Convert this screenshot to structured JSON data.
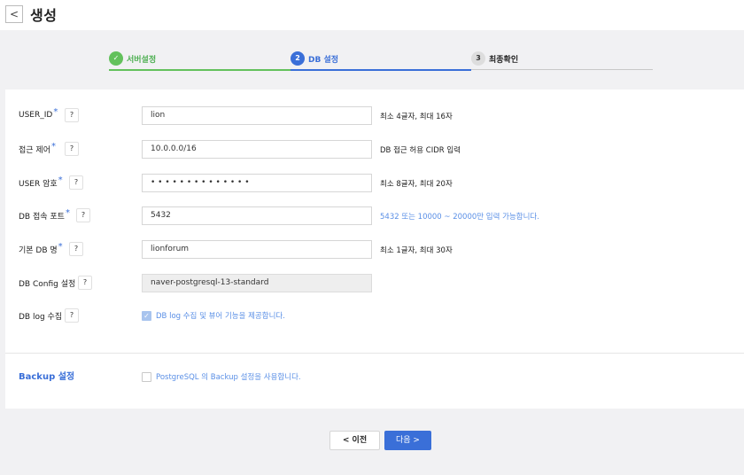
{
  "header": {
    "back_icon": "chevron-left-icon",
    "back_glyph": "<",
    "title": "생성"
  },
  "steps": [
    {
      "label": "서버설정",
      "marker": "✓",
      "state": "done"
    },
    {
      "label": "DB 설정",
      "marker": "2",
      "state": "active"
    },
    {
      "label": "최종확인",
      "marker": "3",
      "state": "pending"
    }
  ],
  "form": {
    "help_glyph": "?",
    "required_mark": "*",
    "user_id": {
      "label": "USER_ID",
      "value": "lion",
      "hint": "최소 4글자, 최대 16자"
    },
    "access_control": {
      "label": "접근 제어",
      "value": "10.0.0.0/16",
      "hint": "DB 접근 허용 CIDR 입력"
    },
    "user_password": {
      "label": "USER 암호",
      "value": "• • • • • • • • • • • • • •",
      "hint": "최소 8글자, 최대 20자"
    },
    "db_port": {
      "label": "DB 접속 포트",
      "value": "5432",
      "hint": "5432 또는 10000 ~ 20000만 입력 가능합니다."
    },
    "default_db_name": {
      "label": "기본 DB 명",
      "value": "lionforum",
      "hint": "최소 1글자, 최대 30자"
    },
    "db_config": {
      "label": "DB Config 설정",
      "value": "naver-postgresql-13-standard"
    },
    "db_log": {
      "label": "DB log 수집",
      "checkbox_label": "DB log 수집 및 뷰어 기능을 제공합니다.",
      "checked": true
    }
  },
  "backup": {
    "title": "Backup 설정",
    "checkbox_label": "PostgreSQL 의 Backup 설정을 사용합니다.",
    "checked": false
  },
  "footer": {
    "prev_label": "< 이전",
    "next_label": "다음 >"
  },
  "colors": {
    "accent": "#3a6fd8",
    "success": "#63c15c",
    "hint_blue": "#5a8fe6"
  }
}
